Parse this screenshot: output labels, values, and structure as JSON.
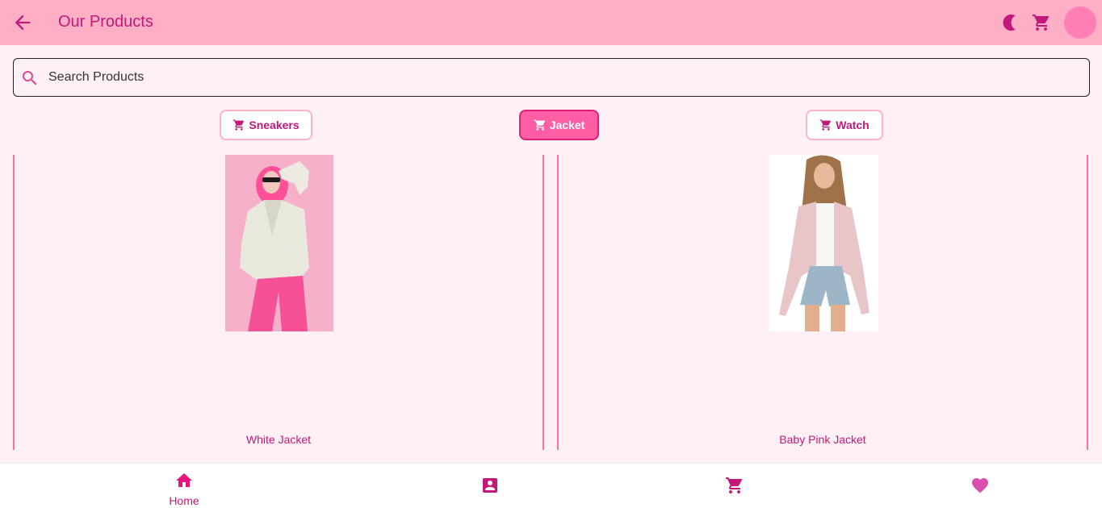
{
  "app_bar": {
    "title": "Our Products",
    "back_icon": "arrow-left-icon",
    "theme_icon": "moon-icon",
    "cart_icon": "cart-icon",
    "colors": {
      "background": "#ffafc5",
      "accent": "#c2187a"
    }
  },
  "search": {
    "placeholder": "Search Products",
    "value": ""
  },
  "categories": [
    {
      "label": "Sneakers",
      "icon": "cart-icon",
      "selected": false
    },
    {
      "label": "Jacket",
      "icon": "cart-icon",
      "selected": true
    },
    {
      "label": "Watch",
      "icon": "cart-icon",
      "selected": false
    }
  ],
  "products": [
    {
      "name": "White Jacket"
    },
    {
      "name": "Baby Pink Jacket"
    }
  ],
  "bottom_nav": [
    {
      "label": "Home",
      "icon": "home-icon",
      "active": true
    },
    {
      "label": "",
      "icon": "contact-icon",
      "active": false
    },
    {
      "label": "",
      "icon": "cart-icon",
      "active": false
    },
    {
      "label": "",
      "icon": "heart-icon",
      "active": false
    }
  ]
}
